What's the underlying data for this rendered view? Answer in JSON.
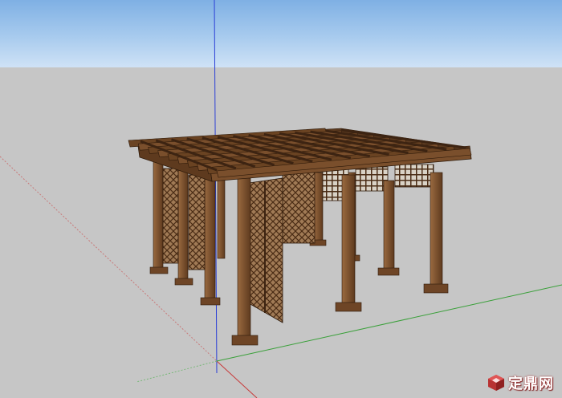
{
  "viewport": {
    "sky_color": "#a8cbee",
    "ground_color": "#c6c6c6",
    "axis_colors": {
      "blue": "#2b3fd6",
      "red": "#c83a3a",
      "green": "#3aa03a"
    },
    "wood_colors": {
      "light": "#8a5f3a",
      "mid": "#6e4526",
      "dark": "#3d2412"
    }
  },
  "watermark": {
    "text": "定鼎网",
    "icon": "red-cube-logo"
  }
}
